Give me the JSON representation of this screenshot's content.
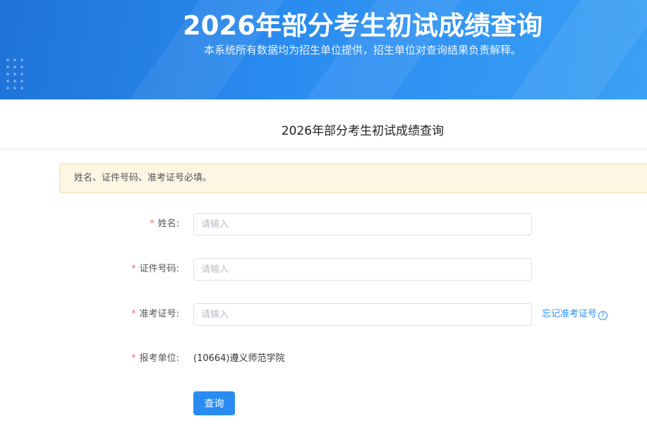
{
  "banner": {
    "title": "2026年部分考生初试成绩查询",
    "subtitle": "本系统所有数据均为招生单位提供，招生单位对查询结果负责解释。"
  },
  "section": {
    "title": "2026年部分考生初试成绩查询"
  },
  "alert": {
    "text": "姓名、证件号码、准考证号必填。"
  },
  "form": {
    "required_mark": "*",
    "name": {
      "label": "姓名:",
      "placeholder": "请输入"
    },
    "id_number": {
      "label": "证件号码:",
      "placeholder": "请输入"
    },
    "exam_number": {
      "label": "准考证号:",
      "placeholder": "请输入",
      "forgot_link": "忘记准考证号",
      "help_icon": "question-circle-icon"
    },
    "unit": {
      "label": "报考单位:",
      "value": "(10664)遵义师范学院"
    },
    "submit_label": "查询"
  },
  "colors": {
    "primary": "#2a8cf0",
    "required": "#f56c6c",
    "alert_bg": "#fdf6e3"
  }
}
